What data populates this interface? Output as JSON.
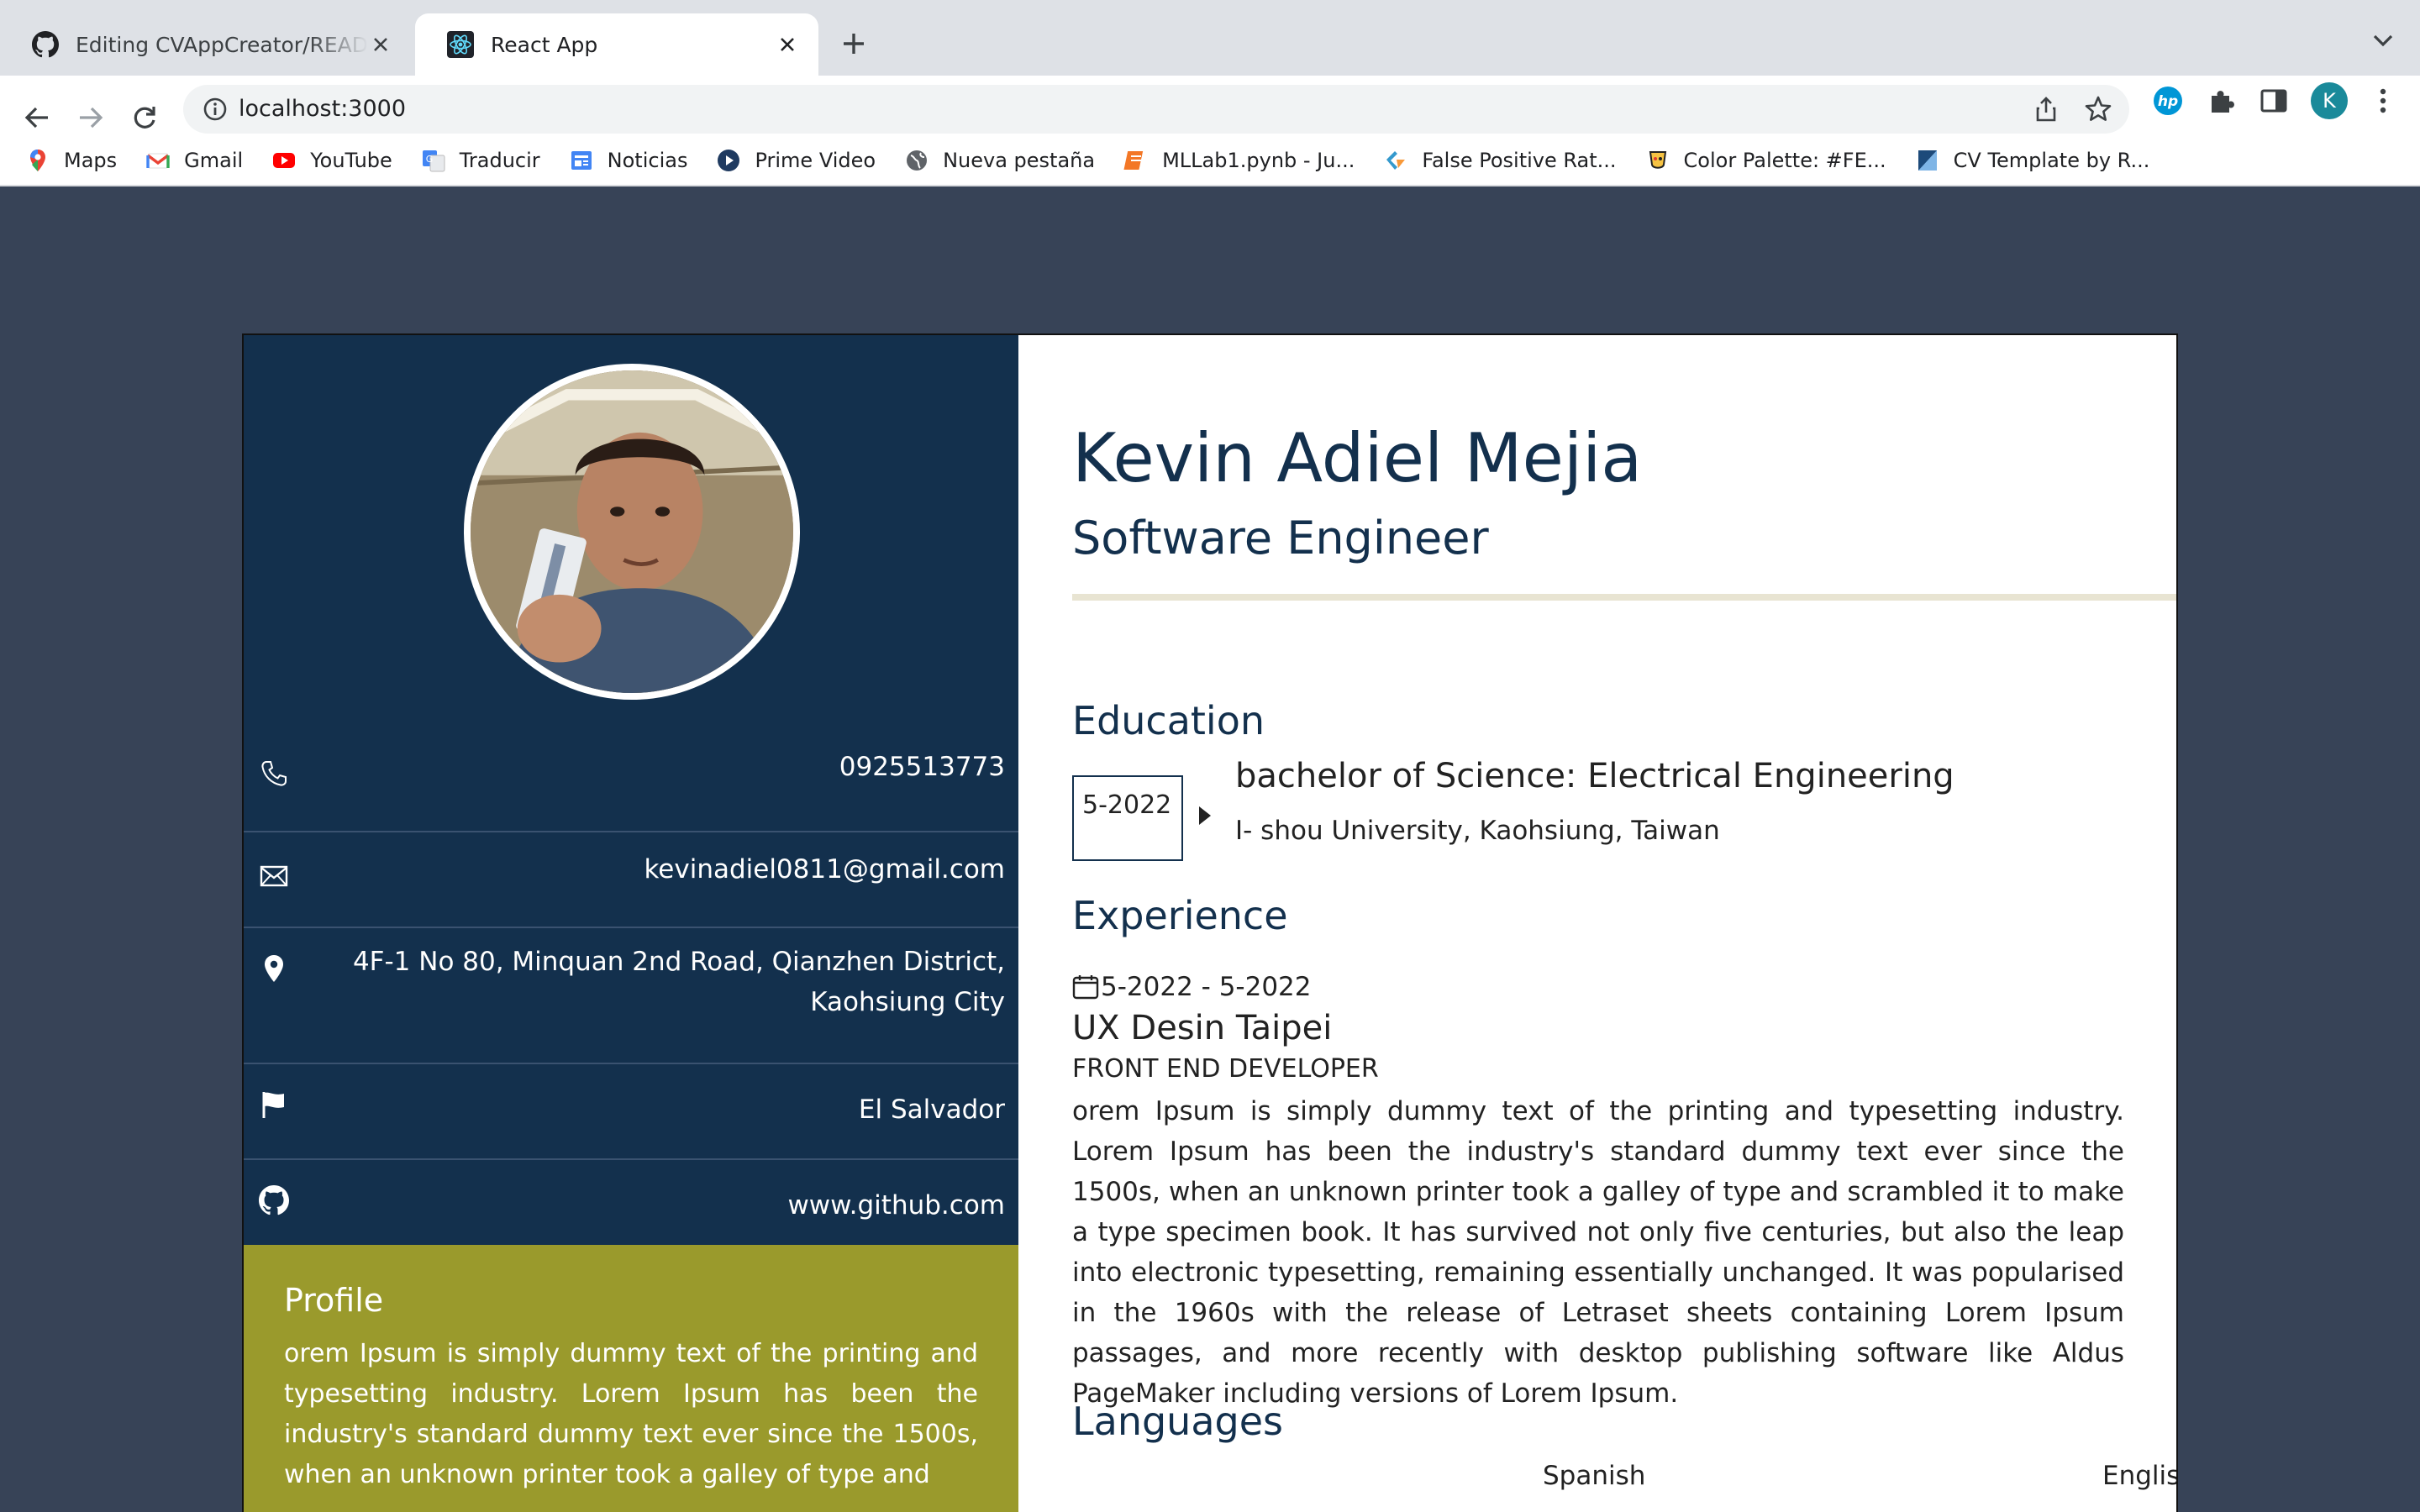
{
  "browser": {
    "tabs": [
      {
        "title": "Editing CVAppCreator/README.md",
        "active": false,
        "icon": "github-icon"
      },
      {
        "title": "React App",
        "active": true,
        "icon": "react-icon"
      }
    ],
    "url": "localhost:3000",
    "profile_initial": "K",
    "bookmarks": [
      {
        "label": "Maps",
        "icon": "maps-icon"
      },
      {
        "label": "Gmail",
        "icon": "gmail-icon"
      },
      {
        "label": "YouTube",
        "icon": "youtube-icon"
      },
      {
        "label": "Traducir",
        "icon": "translate-icon"
      },
      {
        "label": "Noticias",
        "icon": "news-icon"
      },
      {
        "label": "Prime Video",
        "icon": "prime-video-icon"
      },
      {
        "label": "Nueva pestaña",
        "icon": "globe-icon"
      },
      {
        "label": "MLLab1.pynb - Ju...",
        "icon": "jupyter-icon"
      },
      {
        "label": "False Positive Rat...",
        "icon": "scikit-icon"
      },
      {
        "label": "Color Palette: #FE...",
        "icon": "palette-icon"
      },
      {
        "label": "CV Template by R...",
        "icon": "template-icon"
      }
    ]
  },
  "colors": {
    "page_bg": "#374357",
    "sidebar_bg": "#13304d",
    "profile_bg": "#9a9a2c",
    "heading": "#13304d",
    "divider": "#e8e4d2"
  },
  "cv": {
    "name": "Kevin Adiel Mejia",
    "title": "Software Engineer",
    "contact": {
      "phone": "0925513773",
      "email": "kevinadiel0811@gmail.com",
      "address_line1": "4F-1 No 80, Minquan 2nd Road, Qianzhen District,",
      "address_line2": "Kaohsiung City",
      "country": "El Salvador",
      "website": "www.github.com"
    },
    "profile": {
      "heading": "Profile",
      "text": "orem Ipsum is simply dummy text of the printing and typesetting industry. Lorem Ipsum has been the industry's standard dummy text ever since the 1500s, when an unknown printer took a galley of type and"
    },
    "education": {
      "heading": "Education",
      "date": "5-2022",
      "degree": "bachelor of Science: Electrical Engineering",
      "school": "I- shou University, Kaohsiung, Taiwan"
    },
    "experience": {
      "heading": "Experience",
      "date_range": "5-2022 - 5-2022",
      "company": "UX Desin Taipei",
      "role": "FRONT END DEVELOPER",
      "description": "orem Ipsum is simply dummy text of the printing and typesetting industry. Lorem Ipsum has been the industry's standard dummy text ever since the 1500s, when an unknown printer took a galley of type and scrambled it to make a type specimen book. It has survived not only five centuries, but also the leap into electronic typesetting, remaining essentially unchanged. It was popularised in the 1960s with the release of Letraset sheets containing Lorem Ipsum passages, and more recently with desktop publishing software like Aldus PageMaker including versions of Lorem Ipsum."
    },
    "languages": {
      "heading": "Languages",
      "items": [
        "Spanish",
        "English"
      ]
    }
  }
}
